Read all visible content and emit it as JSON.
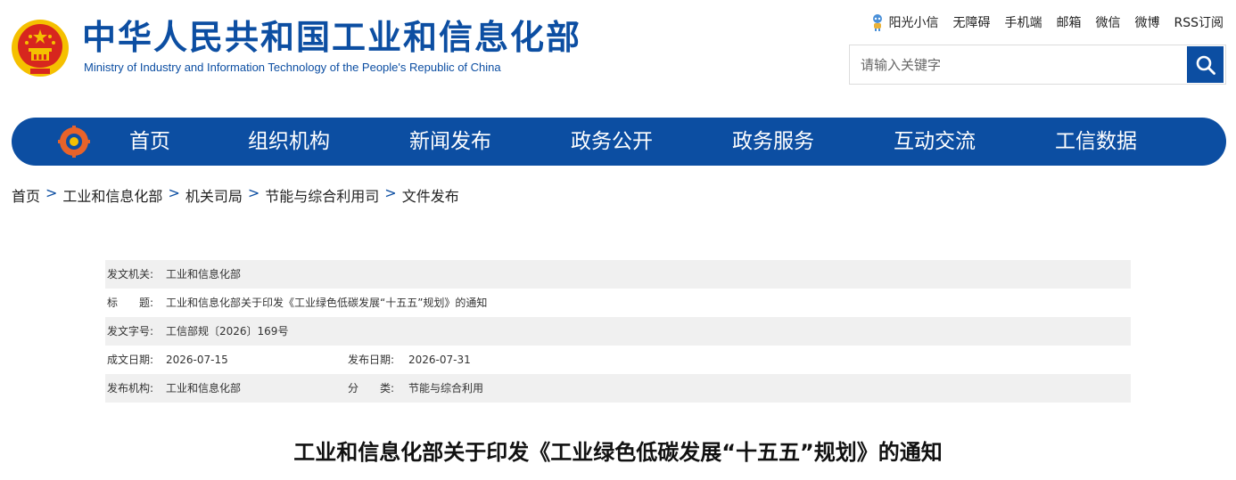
{
  "header": {
    "title_cn": "中华人民共和国工业和信息化部",
    "title_en": "Ministry of Industry and Information Technology of the People's Republic of China",
    "emblem_icon": "national-emblem-icon"
  },
  "toplinks": [
    "阳光小信",
    "无障碍",
    "手机端",
    "邮箱",
    "微信",
    "微博",
    "RSS订阅"
  ],
  "search": {
    "placeholder": "请输入关键字",
    "value": ""
  },
  "nav": {
    "logo_icon": "miit-logo-icon",
    "items": [
      "首页",
      "组织机构",
      "新闻发布",
      "政务公开",
      "政务服务",
      "互动交流",
      "工信数据"
    ]
  },
  "breadcrumb": [
    "首页",
    "工业和信息化部",
    "机关司局",
    "节能与综合利用司",
    "文件发布"
  ],
  "breadcrumb_separator": ">",
  "meta": {
    "issuer_label": "发文机关:",
    "issuer": "工业和信息化部",
    "title_label": "标　　题:",
    "title": "工业和信息化部关于印发《工业绿色低碳发展“十五五”规划》的通知",
    "docno_label": "发文字号:",
    "docno": "工信部规〔2026〕169号",
    "created_label": "成文日期:",
    "created": "2026-07-15",
    "published_label": "发布日期:",
    "published": "2026-07-31",
    "org_label": "发布机构:",
    "org": "工业和信息化部",
    "category_label": "分　　类:",
    "category": "节能与综合利用"
  },
  "doc_title": "工业和信息化部关于印发《工业绿色低碳发展“十五五”规划》的通知",
  "colors": {
    "brand_blue": "#0c4ea2",
    "meta_gray": "#f0f0f0",
    "emblem_red": "#d7261e",
    "emblem_gold": "#f5c000"
  }
}
